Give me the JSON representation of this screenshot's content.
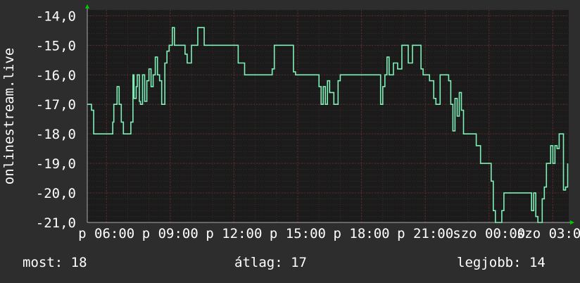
{
  "chart_data": {
    "type": "line",
    "ylabel": "onlinestream.live",
    "ylim": [
      -21,
      -13.8
    ],
    "y_ticks": [
      "-14,0",
      "-15,0",
      "-16,0",
      "-17,0",
      "-18,0",
      "-19,0",
      "-20,0",
      "-21,0"
    ],
    "y_tick_values": [
      -14,
      -15,
      -16,
      -17,
      -18,
      -19,
      -20,
      -21
    ],
    "x_ticks": [
      "p 06:00",
      "p 09:00",
      "p 12:00",
      "p 15:00",
      "p 18:00",
      "p 21:00",
      "szo 00:00",
      "szo 03:00"
    ],
    "x_tick_hours": [
      6,
      9,
      12,
      15,
      18,
      21,
      24,
      27
    ],
    "xlim_hours": [
      5.1,
      27.75
    ],
    "grid": true,
    "colors": {
      "line": "#7ef0b8",
      "background": "#2d2d2d",
      "plot": "#1b1b1b",
      "grid": "#5a2a2a",
      "arrow": "#00cc00"
    },
    "series": [
      {
        "x_hours": [
          5.1,
          5.25,
          5.3,
          5.4,
          5.45,
          5.8,
          6.0,
          6.2,
          6.3,
          6.35,
          6.45,
          6.5,
          6.6,
          6.7,
          6.8,
          6.95,
          7.0,
          7.1,
          7.15,
          7.25,
          7.3,
          7.4,
          7.45,
          7.55,
          7.6,
          7.7,
          7.8,
          7.9,
          8.0,
          8.1,
          8.2,
          8.3,
          8.4,
          8.5,
          8.6,
          8.65,
          8.75,
          8.85,
          8.95,
          9.1,
          9.2,
          9.3,
          9.35,
          9.45,
          9.5,
          9.55,
          9.6,
          9.7,
          9.8,
          10.0,
          10.3,
          10.6,
          10.8,
          11.0,
          11.3,
          11.6,
          11.8,
          12.0,
          12.2,
          12.5,
          12.8,
          13.0,
          13.2,
          13.4,
          13.6,
          13.65,
          13.8,
          13.9,
          14.0,
          14.1,
          14.2,
          14.3,
          14.4,
          14.5,
          14.6,
          14.7,
          14.8,
          14.9,
          15.0,
          15.3,
          15.6,
          15.9,
          16.0,
          16.1,
          16.2,
          16.3,
          16.4,
          16.5,
          16.7,
          16.9,
          17.0,
          17.2,
          17.4,
          17.5,
          17.6,
          17.8,
          17.9,
          18.0,
          18.2,
          18.4,
          18.5,
          18.7,
          18.9,
          19.0,
          19.1,
          19.2,
          19.3,
          19.4,
          19.5,
          19.7,
          19.9,
          20.0,
          20.2,
          20.4,
          20.5,
          20.6,
          20.7,
          20.8,
          20.9,
          21.0,
          21.2,
          21.4,
          21.5,
          21.7,
          21.8,
          21.9,
          22.0,
          22.1,
          22.2,
          22.3,
          22.4,
          22.5,
          22.6,
          22.7,
          22.8,
          22.9,
          23.0,
          23.2,
          23.4,
          23.6,
          23.8,
          24.0,
          24.1,
          24.2,
          24.3,
          24.4,
          24.5,
          24.6,
          24.7,
          24.8,
          24.9,
          25.0,
          25.2,
          25.4,
          25.6,
          25.8,
          26.0,
          26.1,
          26.2,
          26.3,
          26.4,
          26.5,
          26.6,
          26.7,
          26.8,
          26.9,
          27.0,
          27.1,
          27.2,
          27.3,
          27.4,
          27.5,
          27.6,
          27.7
        ],
        "values": [
          -17,
          -17,
          -17.2,
          -18,
          -18,
          -18,
          -18,
          -18,
          -17.6,
          -17,
          -17,
          -16.4,
          -17,
          -17.6,
          -18,
          -18,
          -18,
          -18,
          -17.6,
          -16,
          -16.8,
          -16.4,
          -16,
          -16.9,
          -17,
          -16,
          -16.9,
          -16.2,
          -15.8,
          -16.4,
          -16,
          -15.4,
          -16,
          -16.2,
          -17,
          -17,
          -15.6,
          -15.2,
          -15,
          -14.4,
          -15,
          -15,
          -15,
          -15,
          -15,
          -15,
          -15,
          -15.3,
          -15.6,
          -15,
          -14.4,
          -15,
          -15,
          -15,
          -15,
          -15,
          -15,
          -15,
          -15.6,
          -16,
          -16,
          -16,
          -16,
          -16,
          -16,
          -16,
          -15.8,
          -15,
          -15,
          -15,
          -15,
          -15,
          -15,
          -15,
          -15,
          -15,
          -15.9,
          -16,
          -16,
          -16,
          -16,
          -16,
          -16.4,
          -17,
          -16.4,
          -17,
          -16.2,
          -16.6,
          -17,
          -16.2,
          -16,
          -16,
          -16,
          -16,
          -16,
          -16,
          -16,
          -16,
          -16,
          -16,
          -16,
          -16,
          -17,
          -16.4,
          -16,
          -15.4,
          -16,
          -16,
          -15.6,
          -15.8,
          -15,
          -15,
          -15.6,
          -15,
          -15,
          -15,
          -15,
          -15.8,
          -16,
          -16,
          -16.2,
          -16.8,
          -17,
          -16,
          -16,
          -16,
          -16,
          -16.2,
          -17,
          -17.9,
          -16.8,
          -17.4,
          -16.6,
          -17.2,
          -18,
          -18,
          -18,
          -18,
          -18.4,
          -19,
          -19,
          -19,
          -19.6,
          -20.6,
          -21,
          -21,
          -21,
          -20.6,
          -20,
          -20,
          -20,
          -20,
          -20,
          -20,
          -20,
          -20,
          -20.6,
          -20,
          -20.8,
          -21,
          -21,
          -20.2,
          -19.8,
          -19,
          -19,
          -18.4,
          -19,
          -18.4,
          -18.5,
          -18,
          -18,
          -19.9,
          -19.8,
          -19,
          -18.4,
          -18.4
        ],
        "label_values": []
      }
    ],
    "stats": {
      "now": "most: 18",
      "avg": "átlag: 17",
      "best": "legjobb: 14"
    }
  }
}
